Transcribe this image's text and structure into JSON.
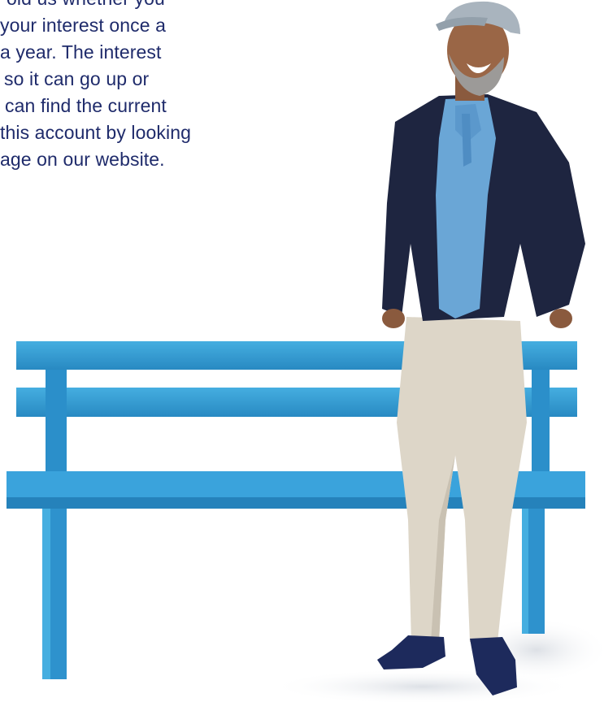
{
  "text_block": {
    "lines": [
      "old us whether you",
      "your interest once a",
      "a year. The interest",
      "so it can go up or",
      "can find the current",
      "this account by looking",
      "age on our website."
    ]
  },
  "colors": {
    "text": "#1f2b6b",
    "bench_blue": "#2f95cf",
    "background": "#ffffff"
  }
}
